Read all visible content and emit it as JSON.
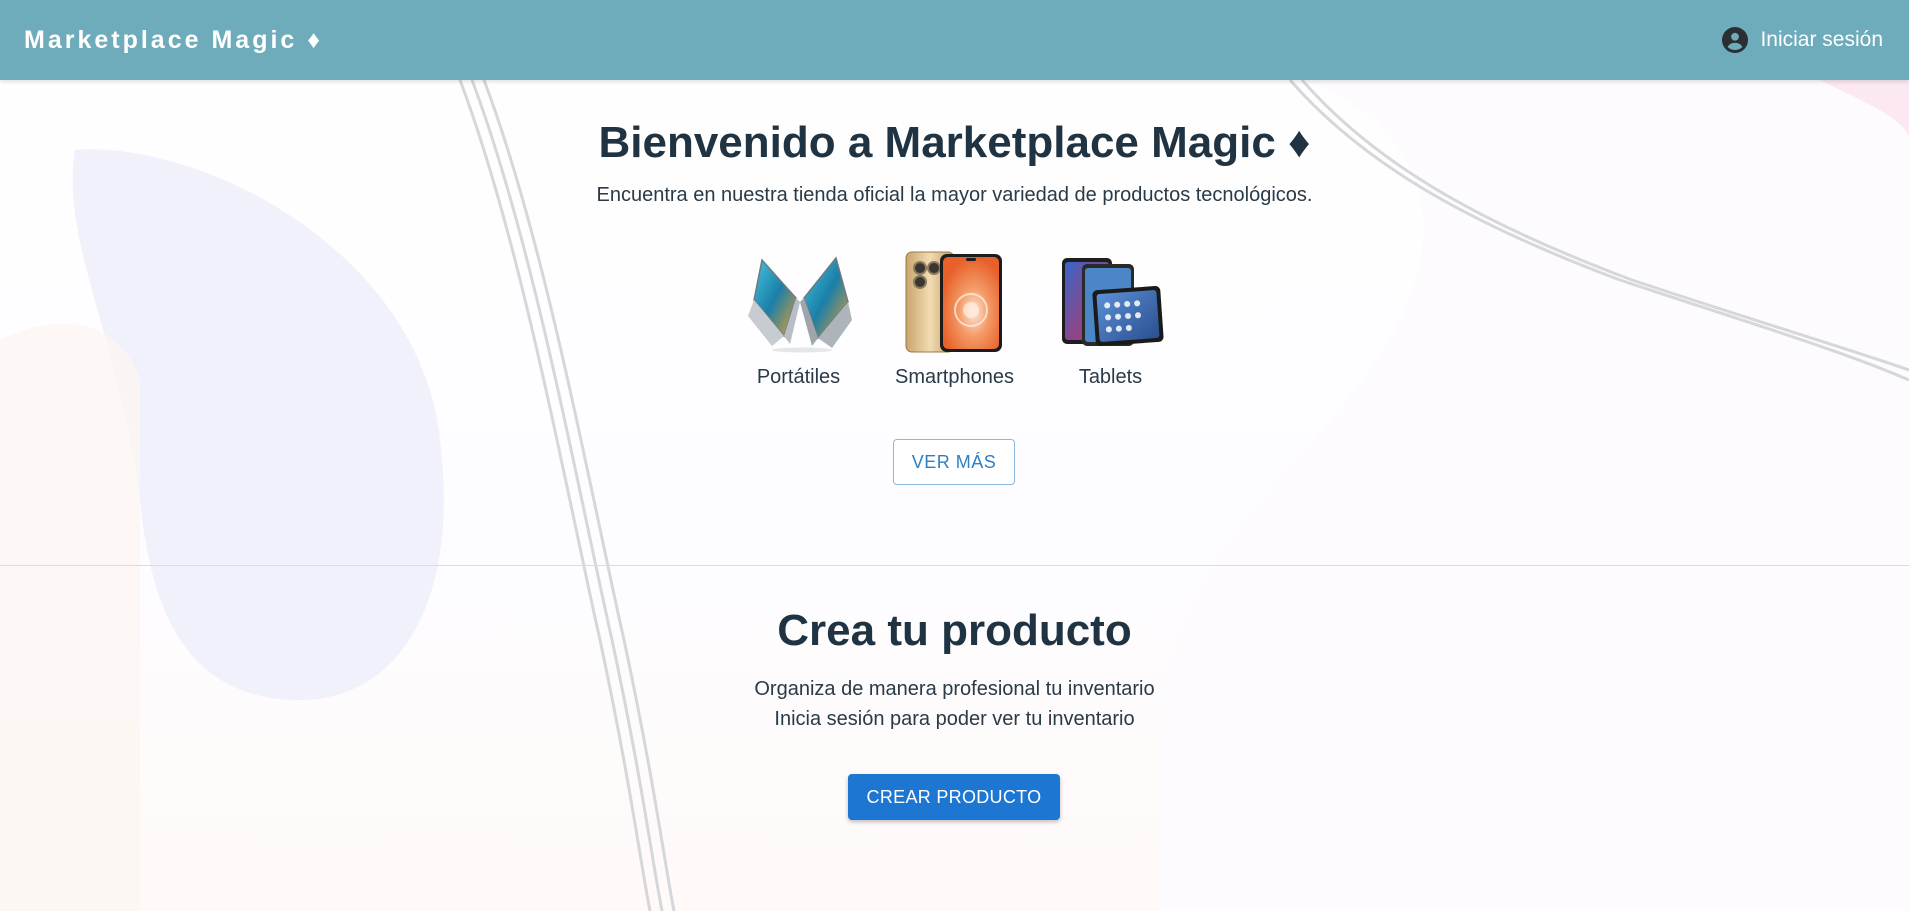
{
  "appbar": {
    "brand": "Marketplace Magic ♦",
    "login_label": "Iniciar sesión",
    "login_icon": "account-circle-icon",
    "color": "#6eacbb"
  },
  "hero": {
    "title": "Bienvenido a Marketplace Magic ♦",
    "subtitle": "Encuentra en nuestra tienda oficial la mayor variedad de productos tecnológicos.",
    "categories": [
      {
        "label": "Portátiles",
        "image": "laptops-image"
      },
      {
        "label": "Smartphones",
        "image": "smartphones-image"
      },
      {
        "label": "Tablets",
        "image": "tablets-image"
      }
    ],
    "see_more_label": "VER MÁS"
  },
  "create": {
    "title": "Crea tu producto",
    "line1": "Organiza de manera profesional tu inventario",
    "line2": "Inicia sesión para poder ver tu inventario",
    "button_label": "CREAR PRODUCTO",
    "button_color": "#1e76d3"
  }
}
